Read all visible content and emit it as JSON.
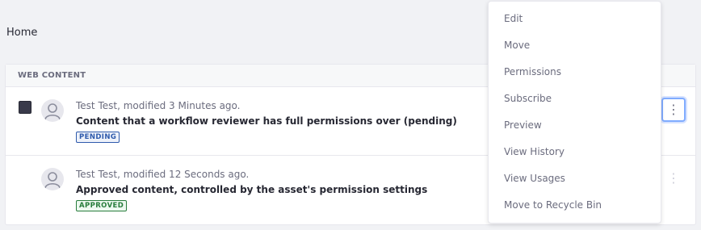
{
  "breadcrumb": {
    "label": "Home"
  },
  "panel": {
    "header": "WEB CONTENT"
  },
  "rows": [
    {
      "meta": "Test Test, modified 3 Minutes ago.",
      "title": "Content that a workflow reviewer has full permissions over (pending)",
      "status": "PENDING",
      "selected": true
    },
    {
      "meta": "Test Test, modified 12 Seconds ago.",
      "title": "Approved content, controlled by the asset's permission settings",
      "status": "APPROVED",
      "selected": false
    }
  ],
  "menu": {
    "items": [
      "Edit",
      "Move",
      "Permissions",
      "Subscribe",
      "Preview",
      "View History",
      "View Usages",
      "Move to Recycle Bin"
    ]
  },
  "icons": {
    "avatar": "user-icon",
    "actions": "ellipsis-vertical-icon"
  },
  "colors": {
    "pending": "#2e5aac",
    "approved": "#287d3c",
    "focus": "#80acff"
  }
}
